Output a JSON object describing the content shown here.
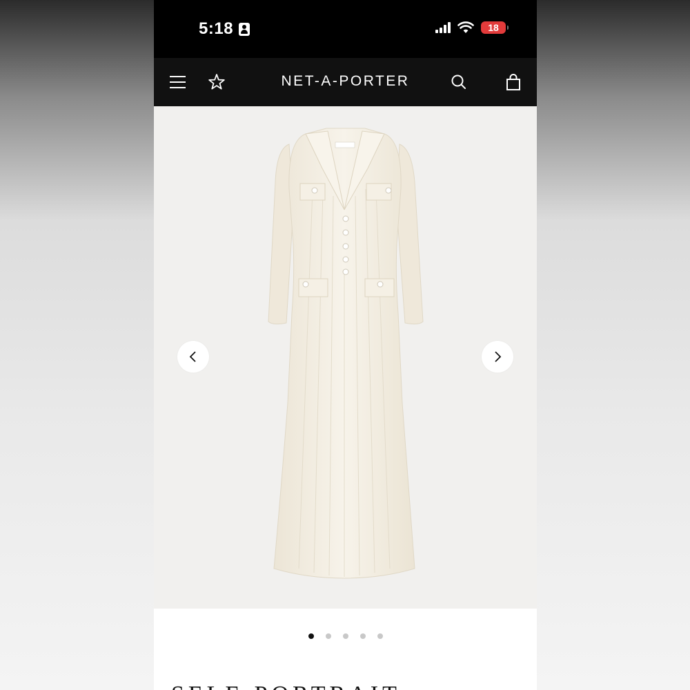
{
  "status_bar": {
    "time": "5:18",
    "battery": "18"
  },
  "header": {
    "brand": "NET-A-PORTER",
    "icons": [
      "menu-icon",
      "star-icon",
      "search-icon",
      "shopping-bag-icon"
    ]
  },
  "gallery": {
    "product_label": "self-portrait",
    "image_count": 5,
    "active_index": 0,
    "dot_color_active": "#111111",
    "dot_color_inactive": "#c8c8c8"
  },
  "product": {
    "designer": "SELF-PORTRAIT"
  },
  "colors": {
    "status_bar_bg": "#000000",
    "nav_bg": "#111111",
    "battery_low": "#e23b3b",
    "dress": "#f4efe3"
  }
}
